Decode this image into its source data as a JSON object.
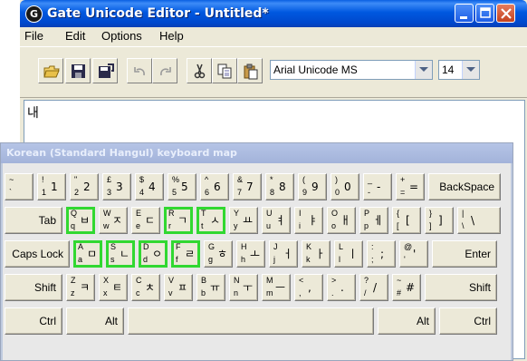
{
  "window": {
    "app_icon_glyph": "G",
    "title": "Gate Unicode Editor - Untitled*",
    "title_bar_color": "#0058e0"
  },
  "menu": [
    "File",
    "Edit",
    "Options",
    "Help"
  ],
  "toolbar": {
    "buttons": [
      "open-icon",
      "save-icon",
      "save-all-icon",
      "undo-icon",
      "redo-icon",
      "cut-icon",
      "copy-icon",
      "paste-icon"
    ],
    "font_name": "Arial Unicode MS",
    "font_size": "14"
  },
  "editor": {
    "text": "내"
  },
  "keyboard": {
    "title": "Korean (Standard Hangul) keyboard map",
    "highlight_color": "#31d831",
    "rows": [
      [
        {
          "tl": "~",
          "bl": "`",
          "main": ""
        },
        {
          "tl": "!",
          "bl": "1",
          "main": "1"
        },
        {
          "tl": "\"",
          "bl": "2",
          "main": "2"
        },
        {
          "tl": "£",
          "bl": "3",
          "main": "3"
        },
        {
          "tl": "$",
          "bl": "4",
          "main": "4"
        },
        {
          "tl": "%",
          "bl": "5",
          "main": "5"
        },
        {
          "tl": "^",
          "bl": "6",
          "main": "6"
        },
        {
          "tl": "&",
          "bl": "7",
          "main": "7"
        },
        {
          "tl": "*",
          "bl": "8",
          "main": "8"
        },
        {
          "tl": "(",
          "bl": "9",
          "main": "9"
        },
        {
          "tl": ")",
          "bl": "0",
          "main": "0"
        },
        {
          "tl": "_",
          "bl": "-",
          "main": "-"
        },
        {
          "tl": "+",
          "bl": "=",
          "main": "="
        },
        {
          "label": "BackSpace"
        }
      ],
      [
        {
          "label": "Tab"
        },
        {
          "tl": "Q",
          "bl": "q",
          "main": "ㅂ",
          "hl": true
        },
        {
          "tl": "W",
          "bl": "w",
          "main": "ㅈ"
        },
        {
          "tl": "E",
          "bl": "e",
          "main": "ㄷ"
        },
        {
          "tl": "R",
          "bl": "r",
          "main": "ㄱ",
          "hl": true
        },
        {
          "tl": "T",
          "bl": "t",
          "main": "ㅅ",
          "hl": true
        },
        {
          "tl": "Y",
          "bl": "y",
          "main": "ㅛ"
        },
        {
          "tl": "U",
          "bl": "u",
          "main": "ㅕ"
        },
        {
          "tl": "I",
          "bl": "i",
          "main": "ㅑ"
        },
        {
          "tl": "O",
          "bl": "o",
          "main": "ㅐ"
        },
        {
          "tl": "P",
          "bl": "p",
          "main": "ㅔ"
        },
        {
          "tl": "{",
          "bl": "[",
          "main": "["
        },
        {
          "tl": "}",
          "bl": "]",
          "main": "]"
        },
        {
          "tl": "|",
          "bl": "\\",
          "main": "\\"
        }
      ],
      [
        {
          "label": "Caps Lock"
        },
        {
          "tl": "A",
          "bl": "a",
          "main": "ㅁ",
          "hl": true
        },
        {
          "tl": "S",
          "bl": "s",
          "main": "ㄴ",
          "hl": true
        },
        {
          "tl": "D",
          "bl": "d",
          "main": "ㅇ",
          "hl": true
        },
        {
          "tl": "F",
          "bl": "f",
          "main": "ㄹ",
          "hl": true
        },
        {
          "tl": "G",
          "bl": "g",
          "main": "ㅎ"
        },
        {
          "tl": "H",
          "bl": "h",
          "main": "ㅗ"
        },
        {
          "tl": "J",
          "bl": "j",
          "main": "ㅓ"
        },
        {
          "tl": "K",
          "bl": "k",
          "main": "ㅏ"
        },
        {
          "tl": "L",
          "bl": "l",
          "main": "ㅣ"
        },
        {
          "tl": ":",
          "bl": ";",
          "main": ";"
        },
        {
          "tl": "@",
          "bl": "'",
          "main": "'"
        },
        {
          "label": "Enter"
        }
      ],
      [
        {
          "label": "Shift"
        },
        {
          "tl": "Z",
          "bl": "z",
          "main": "ㅋ"
        },
        {
          "tl": "X",
          "bl": "x",
          "main": "ㅌ"
        },
        {
          "tl": "C",
          "bl": "c",
          "main": "ㅊ"
        },
        {
          "tl": "V",
          "bl": "v",
          "main": "ㅍ"
        },
        {
          "tl": "B",
          "bl": "b",
          "main": "ㅠ"
        },
        {
          "tl": "N",
          "bl": "n",
          "main": "ㅜ"
        },
        {
          "tl": "M",
          "bl": "m",
          "main": "ㅡ"
        },
        {
          "tl": "<",
          "bl": ",",
          "main": ","
        },
        {
          "tl": ">",
          "bl": ".",
          "main": "."
        },
        {
          "tl": "?",
          "bl": "/",
          "main": "/"
        },
        {
          "tl": "~",
          "bl": "#",
          "main": "#"
        },
        {
          "label": "Shift"
        }
      ],
      [
        {
          "label": "Ctrl"
        },
        {
          "label": "Alt"
        },
        {
          "label": ""
        },
        {
          "label": "Alt"
        },
        {
          "label": "Ctrl"
        }
      ]
    ]
  }
}
